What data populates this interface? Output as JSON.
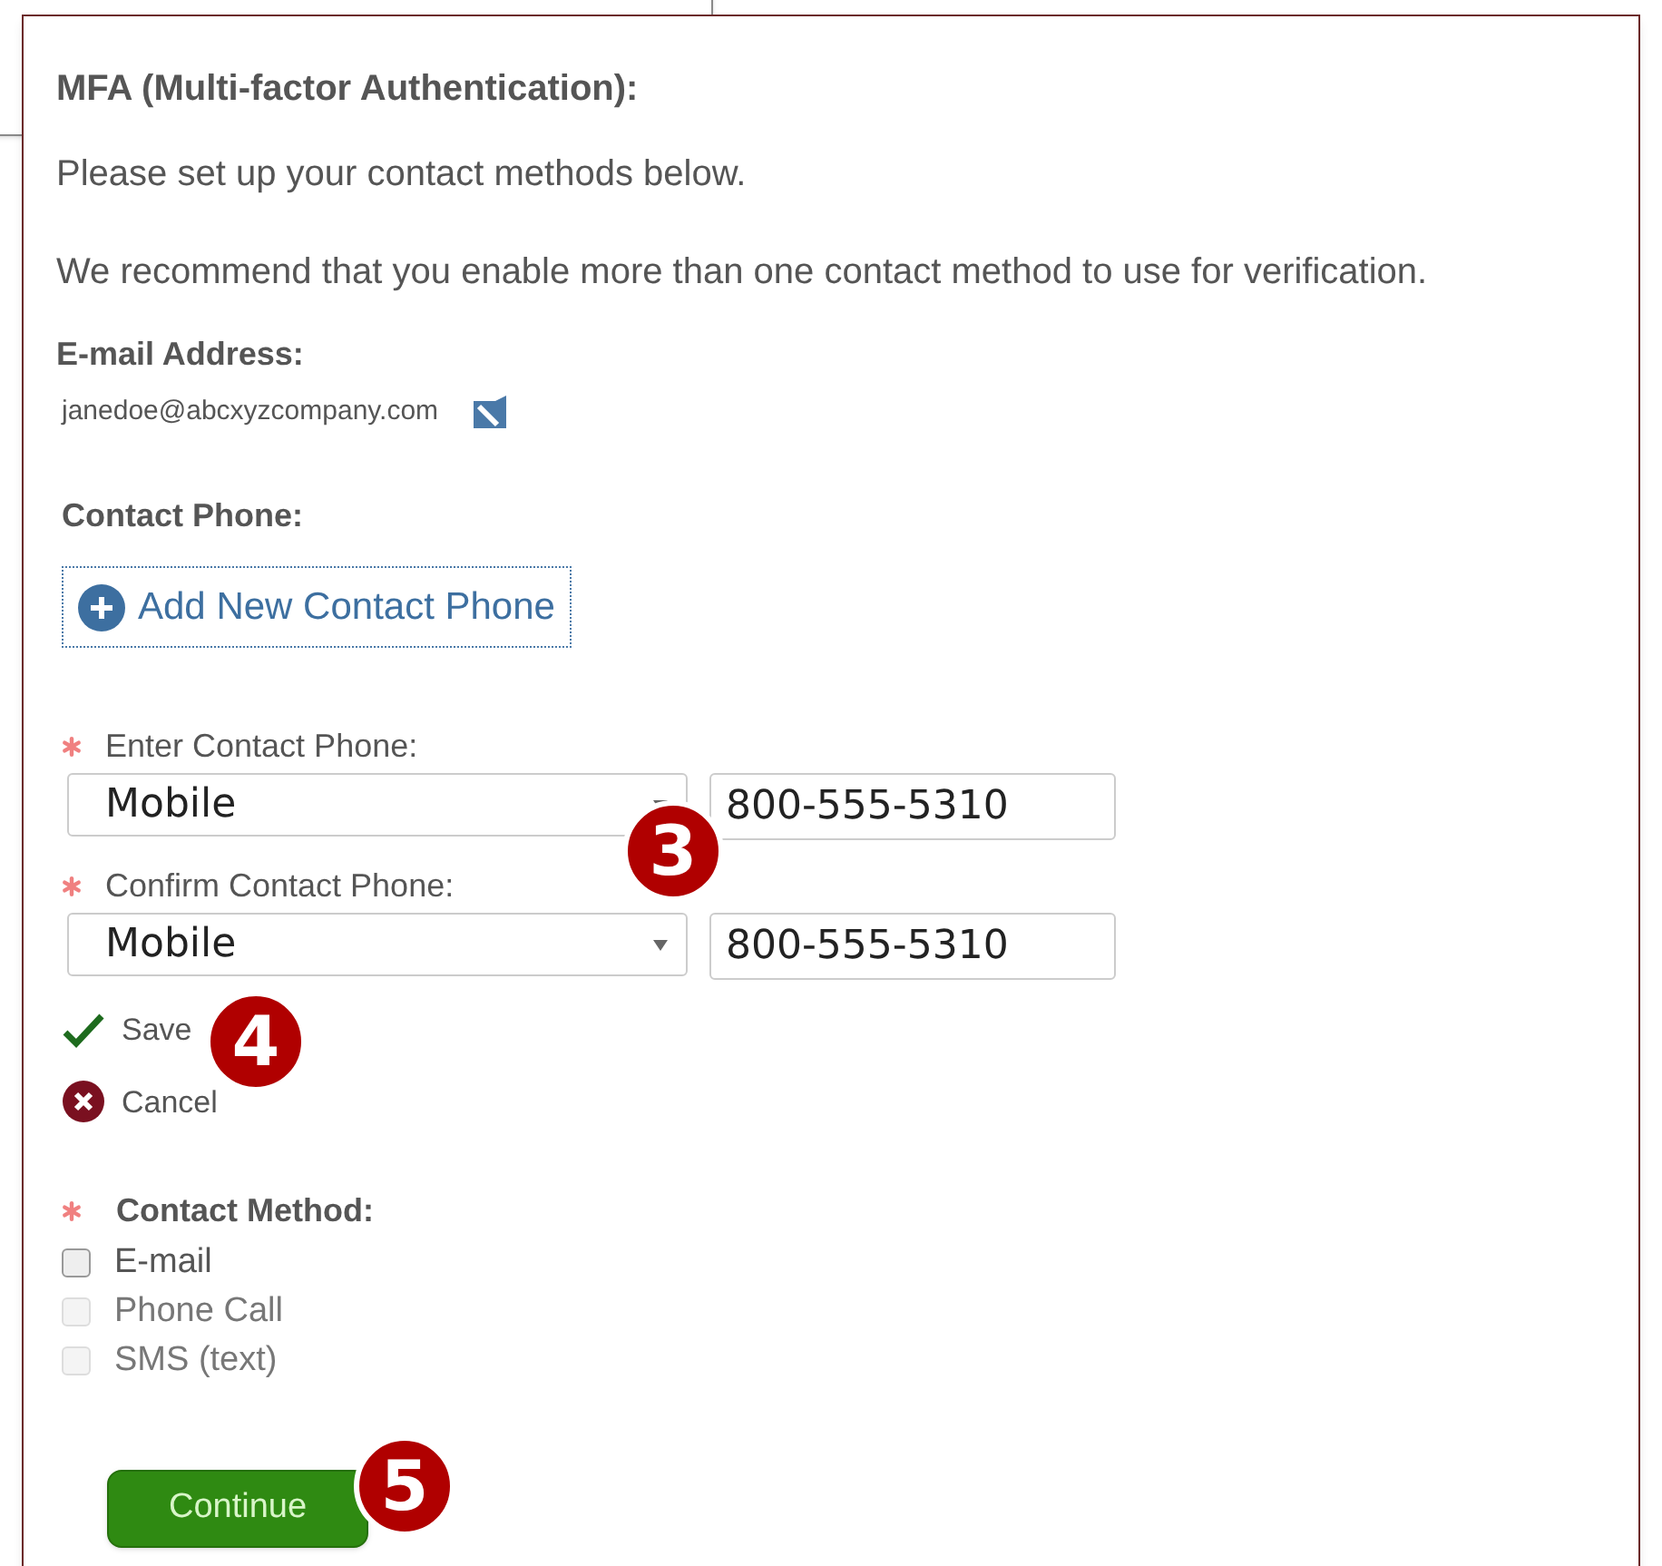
{
  "title": "MFA (Multi-factor Authentication):",
  "intro": [
    "Please set up your contact methods below.",
    "We recommend that you enable more than one contact method to use for verification."
  ],
  "email": {
    "label": "E-mail Address:",
    "value": "janedoe@abcxyzcompany.com"
  },
  "contact_phone": {
    "label": "Contact Phone:",
    "add_button": "Add New Contact Phone"
  },
  "phone_entries": [
    {
      "label": "Enter Contact Phone:",
      "required": true,
      "type": "Mobile",
      "number": "800-555-5310"
    },
    {
      "label": "Confirm Contact Phone:",
      "required": true,
      "type": "Mobile",
      "number": "800-555-5310"
    }
  ],
  "actions": [
    {
      "kind": "save",
      "label": "Save"
    },
    {
      "kind": "cancel",
      "label": "Cancel"
    }
  ],
  "contact_method": {
    "label": "Contact Method:",
    "required": true,
    "options": [
      {
        "label": "E-mail",
        "checked": false,
        "disabled": false
      },
      {
        "label": "Phone Call",
        "checked": false,
        "disabled": true
      },
      {
        "label": "SMS (text)",
        "checked": false,
        "disabled": true
      }
    ]
  },
  "continue_button": "Continue",
  "callouts": [
    "3",
    "4",
    "5"
  ]
}
